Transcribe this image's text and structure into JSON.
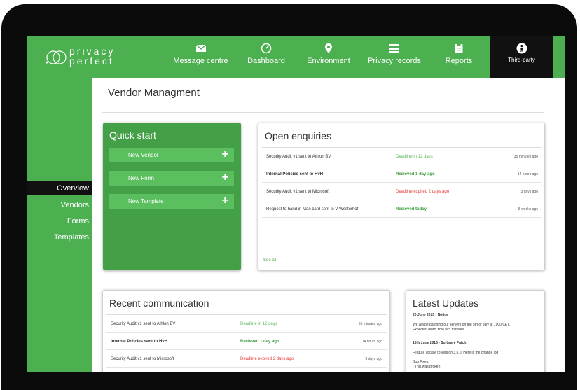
{
  "brand": {
    "line1": "privacy",
    "line2": "perfect"
  },
  "nav": [
    {
      "label": "Message centre",
      "icon": "envelope-icon"
    },
    {
      "label": "Dashboard",
      "icon": "gauge-icon"
    },
    {
      "label": "Environment",
      "icon": "map-pin-icon"
    },
    {
      "label": "Privacy records",
      "icon": "list-icon"
    },
    {
      "label": "Reports",
      "icon": "clipboard-icon"
    },
    {
      "label": "Third-party",
      "icon": "person-circle-icon",
      "active": true
    }
  ],
  "sidebar": {
    "items": [
      "Overview",
      "Vendors",
      "Forms",
      "Templates"
    ],
    "active": "Overview"
  },
  "page": {
    "title": "Vendor Managment"
  },
  "quick_start": {
    "title": "Quick start",
    "buttons": [
      "New Vendor",
      "New Form",
      "New Template"
    ]
  },
  "open_enquiries": {
    "title": "Open enquiries",
    "rows": [
      {
        "subject": "Security Audit v1 sent to Athlon BV",
        "status": "Deadline in 12 days",
        "status_type": "pending",
        "time": "35 minutes ago"
      },
      {
        "subject": "Internal Policies sent to HvH",
        "status": "Recieved 1 day ago",
        "status_type": "received",
        "time": "14 hours ago"
      },
      {
        "subject": "Security Audit v1 sent to Microsoft",
        "status": "Deadline expired 2 days ago",
        "status_type": "expired",
        "time": "3 days ago"
      },
      {
        "subject": "Request to hand in Man card sent to V Westerhof",
        "status": "Recieved today",
        "status_type": "received",
        "time": "5 weeks ago"
      }
    ],
    "see_all": "See all"
  },
  "recent_communication": {
    "title": "Recent communication",
    "rows": [
      {
        "subject": "Security Audit v1 sent to Athlon BV",
        "status": "Deadline in 12 days",
        "status_type": "pending",
        "time": "35 minutes ago"
      },
      {
        "subject": "Internal Policies sent to HvH",
        "status": "Recieved 1 day ago",
        "status_type": "received",
        "time": "14 hours ago"
      },
      {
        "subject": "Security Audit v1 sent to Microsoft",
        "status": "Deadline expired 2 days ago",
        "status_type": "expired",
        "time": "3 days ago"
      }
    ]
  },
  "latest_updates": {
    "title": "Latest Updates",
    "entries": [
      {
        "heading": "20 June 2015 - Notice",
        "lines": [
          "We will be patching our servers on the 5th of July at 1900 CET.",
          "Expected down time is 5 minutes"
        ]
      },
      {
        "heading": "16th June 2015 - Software Patch",
        "lines": [
          "Feature update to version 3.5.0. Here is the change log",
          "Bug Fixes:",
          "- This was broken"
        ]
      }
    ]
  },
  "colors": {
    "brand_green": "#4caf50",
    "card_green": "#43a047",
    "button_green": "#5cbf5f",
    "status_pending": "#5cb85c",
    "status_received": "#3d9b3d",
    "status_expired": "#e53935",
    "active_dark": "#111111"
  }
}
